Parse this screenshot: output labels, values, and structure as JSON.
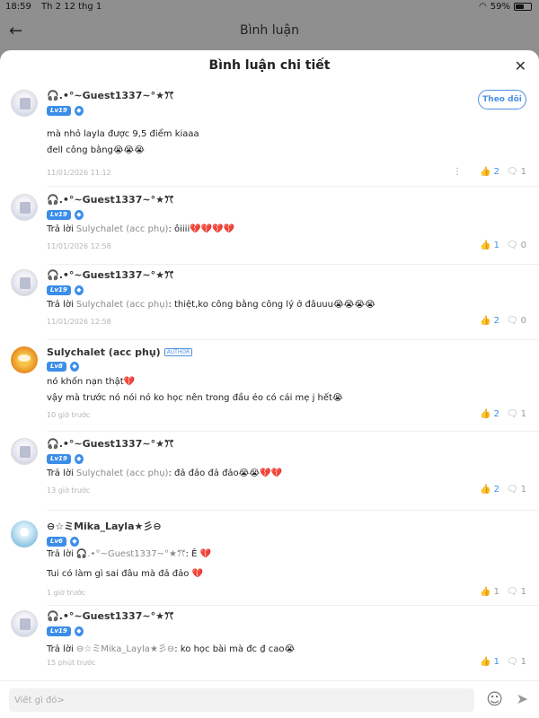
{
  "status": {
    "time": "18:59",
    "date": "Th 2 12 thg 1",
    "battery": "59%",
    "battery_level": 0.59,
    "wifi_icon": "wifi-icon"
  },
  "app_header": {
    "title": "Bình luận",
    "back_icon": "arrow-left-icon"
  },
  "sheet": {
    "title": "Bình luận chi tiết",
    "close_icon": "close-icon",
    "follow_label": "Theo dõi"
  },
  "comments": [
    {
      "user": "🎧.•°~Guest1337~°★ꔫ",
      "level": "Lv19",
      "lines": [
        "mà nhỏ layla được 9,5 điểm kiaaa",
        "đell công bằng😭😭😭"
      ],
      "time": "11/01/2026 11:12",
      "likes": "2",
      "replies": "1"
    },
    {
      "user": "🎧.•°~Guest1337~°★ꔫ",
      "level": "Lv19",
      "reply_prefix": "Trả lời ",
      "reply_to": "Sulychalet (acc phụ)",
      "text": ": ôiiii💔💔💔💔",
      "time": "11/01/2026 12:58",
      "likes": "1",
      "replies": "0"
    },
    {
      "user": "🎧.•°~Guest1337~°★ꔫ",
      "level": "Lv19",
      "reply_prefix": "Trả lời ",
      "reply_to": "Sulychalet (acc phụ)",
      "text": ": thiệt,ko công bằng công lý ở đâuuu😭😭😭😭",
      "time": "11/01/2026 12:58",
      "likes": "2",
      "replies": "0"
    },
    {
      "user": "Sulychalet (acc phụ)",
      "author_badge": "AUTHOR",
      "level": "Lv8",
      "lines": [
        "nó khốn nạn thật💔",
        "vậy mà trước nó nói nó ko học nên trong đầu éo có cái mẹ j hết😭"
      ],
      "time": "10 giờ trước",
      "likes": "2",
      "replies": "1"
    },
    {
      "user": "🎧.•°~Guest1337~°★ꔫ",
      "level": "Lv19",
      "reply_prefix": "Trả lời ",
      "reply_to": "Sulychalet (acc phụ)",
      "text": ": đả đảo đả đảo😭😭💔💔",
      "time": "13 giờ trước",
      "likes": "2",
      "replies": "1"
    },
    {
      "user": "⊖☆ミMika_Layla★彡⊖",
      "level": "Lv6",
      "reply_prefix": "Trả lời ",
      "reply_to": "🎧.•°~Guest1337~°★ꔫ",
      "text": ": Ê 💔",
      "line2": "Tui có làm gì sai đâu mà đả đảo 💔",
      "time": "1 giờ trước",
      "likes": "1",
      "replies": "1"
    },
    {
      "user": "🎧.•°~Guest1337~°★ꔫ",
      "level": "Lv19",
      "reply_prefix": "Trả lời ",
      "reply_to": "⊖☆ミMika_Layla★彡⊖",
      "text": ": ko học bài mà đc ₫ cao😭",
      "time": "15 phút trước",
      "likes": "1",
      "replies": "1"
    }
  ],
  "input": {
    "placeholder": "Viết gì đó>",
    "emoji_icon": "smiley-icon",
    "send_icon": "send-icon"
  },
  "colors": {
    "accent": "#3b8ee8",
    "dim_overlay": "#8f8f8f"
  }
}
